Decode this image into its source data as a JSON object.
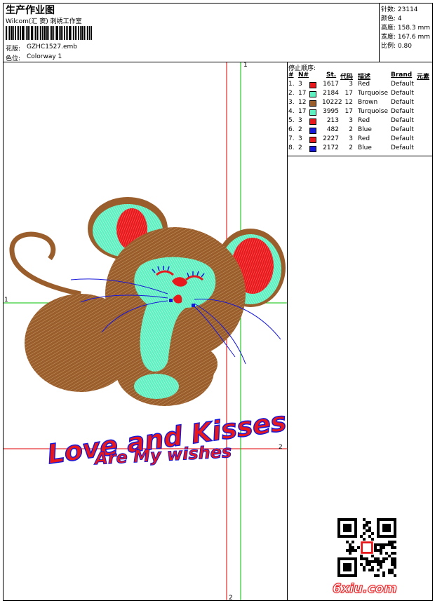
{
  "header": {
    "title": "生产作业图",
    "software": "Wilcom(汇 窦) 刺绣工作室",
    "design_label": "花版:",
    "design_value": "GZHC1527.emb",
    "colorway_label": "色位:",
    "colorway_value": "Colorway 1"
  },
  "stats": {
    "stitches": "针数: 23114",
    "colors": "颜色: 4",
    "height": "高度: 158.3 mm",
    "width": "宽度: 167.6 mm",
    "scale": "比例: 0.80"
  },
  "stop_sequence": {
    "title": "停止顺序:",
    "headers": [
      "#",
      "N#",
      "St.",
      "代码",
      "描述",
      "Brand",
      "元素"
    ],
    "rows": [
      {
        "idx": "1.",
        "n": "3",
        "color": "#e8191c",
        "st": "1617",
        "code": "3",
        "desc": "Red",
        "brand": "Default"
      },
      {
        "idx": "2.",
        "n": "17",
        "color": "#5ef0c0",
        "st": "2184",
        "code": "17",
        "desc": "Turquoise",
        "brand": "Default"
      },
      {
        "idx": "3.",
        "n": "12",
        "color": "#9a5e2c",
        "st": "10222",
        "code": "12",
        "desc": "Brown",
        "brand": "Default"
      },
      {
        "idx": "4.",
        "n": "17",
        "color": "#5ef0c0",
        "st": "3995",
        "code": "17",
        "desc": "Turquoise",
        "brand": "Default"
      },
      {
        "idx": "5.",
        "n": "3",
        "color": "#e8191c",
        "st": "213",
        "code": "3",
        "desc": "Red",
        "brand": "Default"
      },
      {
        "idx": "6.",
        "n": "2",
        "color": "#1818d8",
        "st": "482",
        "code": "2",
        "desc": "Blue",
        "brand": "Default"
      },
      {
        "idx": "7.",
        "n": "3",
        "color": "#e8191c",
        "st": "2227",
        "code": "3",
        "desc": "Red",
        "brand": "Default"
      },
      {
        "idx": "8.",
        "n": "2",
        "color": "#1818d8",
        "st": "2172",
        "code": "2",
        "desc": "Blue",
        "brand": "Default"
      }
    ]
  },
  "design": {
    "line1": "Love and Kisses",
    "line2": "Are My wishes",
    "marker_1_top": "1",
    "marker_1_left": "1",
    "marker_2_right": "2",
    "marker_2_bottom": "2",
    "colors": {
      "brown": "#9a5e2c",
      "turquoise": "#5ef0c0",
      "red": "#e8191c",
      "blue": "#1818d8",
      "guide_red": "#e00000",
      "guide_green": "#00c000"
    }
  },
  "watermark": {
    "site": "6xiu.com"
  }
}
